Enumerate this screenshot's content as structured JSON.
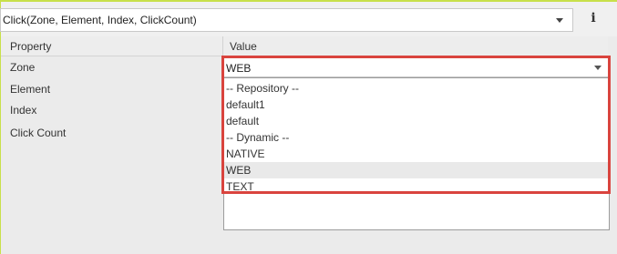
{
  "method_select": {
    "value": "Click(Zone, Element, Index, ClickCount)"
  },
  "info_icon": "i",
  "grid": {
    "header_property": "Property",
    "header_value": "Value",
    "rows": [
      "Zone",
      "Element",
      "Index",
      "Click Count"
    ]
  },
  "zone_field": {
    "value": "WEB"
  },
  "dropdown": {
    "options": [
      "-- Repository --",
      "default1",
      "default",
      "-- Dynamic --",
      "NATIVE",
      "WEB",
      "TEXT"
    ],
    "selected": "WEB"
  },
  "colors": {
    "accent_line": "#c8e04a",
    "highlight": "#d9443e",
    "selected_row": "#e9e9e9"
  }
}
